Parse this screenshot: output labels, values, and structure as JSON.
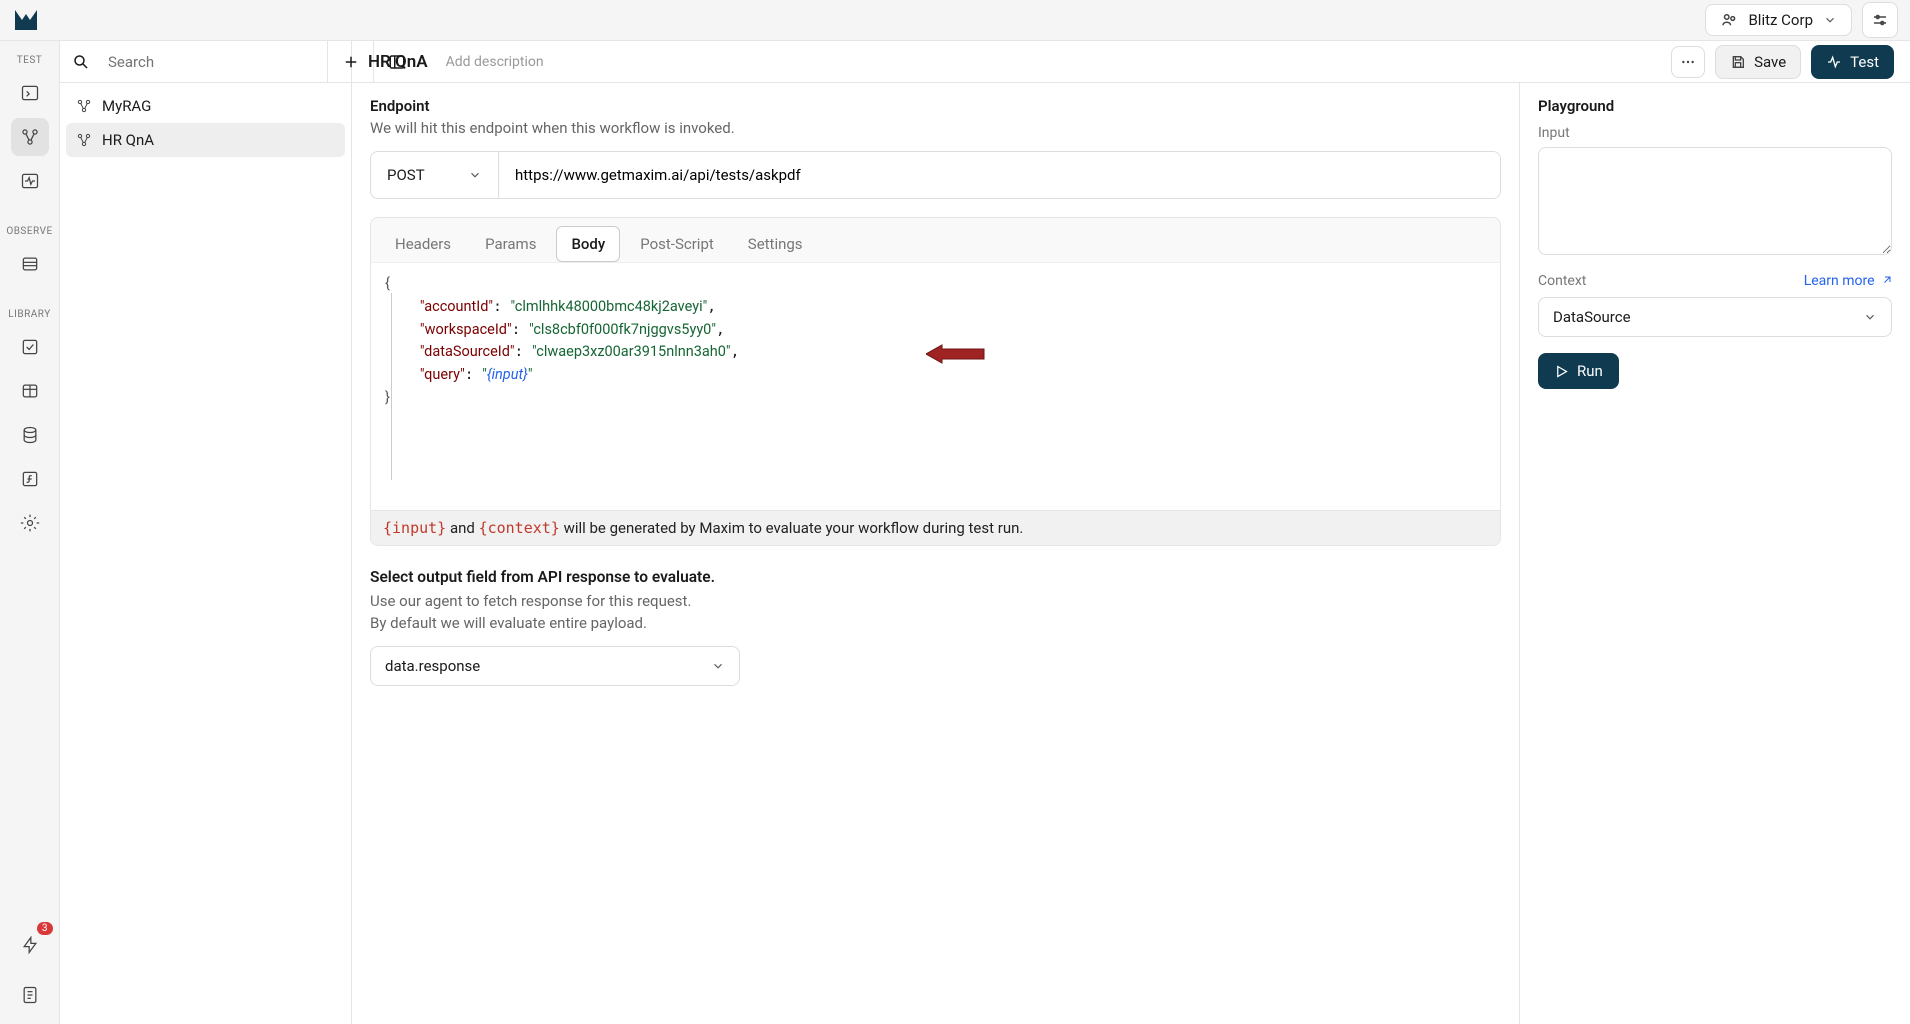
{
  "topbar": {
    "org_name": "Blitz Corp"
  },
  "rail": {
    "label_test": "TEST",
    "label_observe": "OBSERVE",
    "label_library": "LIBRARY",
    "notification_count": "3"
  },
  "sidebar": {
    "search_placeholder": "Search",
    "items": [
      {
        "label": "MyRAG"
      },
      {
        "label": "HR QnA"
      }
    ]
  },
  "header": {
    "title": "HR QnA",
    "add_desc": "Add description",
    "save_label": "Save",
    "test_label": "Test"
  },
  "endpoint": {
    "title": "Endpoint",
    "subtitle": "We will hit this endpoint when this workflow is invoked.",
    "method": "POST",
    "url": "https://www.getmaxim.ai/api/tests/askpdf"
  },
  "tabs": {
    "headers": "Headers",
    "params": "Params",
    "body": "Body",
    "post_script": "Post-Script",
    "settings": "Settings"
  },
  "body_json": {
    "l1": "{",
    "l2_k": "\"accountId\"",
    "l2_v": "\"clmlhhk48000bmc48kj2aveyi\"",
    "l3_k": "\"workspaceId\"",
    "l3_v": "\"cls8cbf0f000fk7njggvs5yy0\"",
    "l4_k": "\"dataSourceId\"",
    "l4_v": "\"clwaep3xz00ar3915nlnn3ah0\"",
    "l5_k": "\"query\"",
    "l5_q": "\"",
    "l5_var": "{input}",
    "l5_q2": "\"",
    "l6": "}"
  },
  "hint": {
    "tok1": "{input}",
    "mid": " and ",
    "tok2": "{context}",
    "rest": " will be generated by Maxim to evaluate your workflow during test run."
  },
  "output": {
    "title": "Select output field from API response to evaluate.",
    "sub1": "Use our agent to fetch response for this request.",
    "sub2": "By default we will evaluate entire payload.",
    "select_value": "data.response"
  },
  "playground": {
    "title": "Playground",
    "input_label": "Input",
    "context_label": "Context",
    "learn_more": "Learn more",
    "datasource_value": "DataSource",
    "run_label": "Run"
  }
}
